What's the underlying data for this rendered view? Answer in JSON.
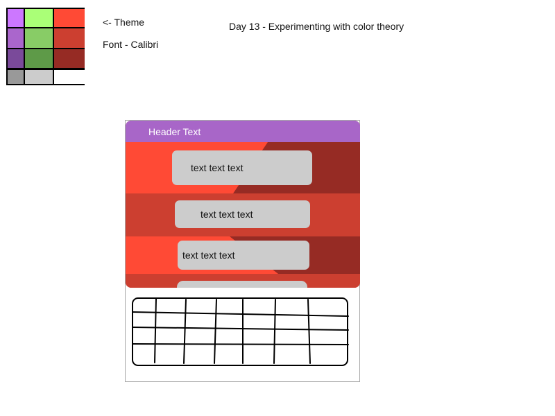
{
  "theme": {
    "label": "<- Theme",
    "font_label": "Font - Calibri",
    "swatches": [
      {
        "name": "light-purple",
        "color": "#cc77ff"
      },
      {
        "name": "light-green",
        "color": "#aaff77"
      },
      {
        "name": "red",
        "color": "#ff4a35"
      },
      {
        "name": "purple",
        "color": "#aa66cc"
      },
      {
        "name": "green",
        "color": "#88cc66"
      },
      {
        "name": "medium-red",
        "color": "#cc3f30"
      },
      {
        "name": "dark-purple",
        "color": "#7a4a9a"
      },
      {
        "name": "dark-green",
        "color": "#5e9a48"
      },
      {
        "name": "dark-red",
        "color": "#962b24"
      },
      {
        "name": "gray",
        "color": "#999999"
      },
      {
        "name": "light-gray",
        "color": "#cccccc"
      },
      {
        "name": "white",
        "color": "#ffffff"
      }
    ]
  },
  "title": "Day 13 - Experimenting with color theory",
  "mockup": {
    "header_text": "Header Text",
    "bubbles": [
      {
        "text": "text text text"
      },
      {
        "text": "text text text"
      },
      {
        "text": "text text text"
      }
    ],
    "colors": {
      "header": "#a866c8",
      "red": "#ff4a35",
      "medium_red": "#cc3f30",
      "dark_red": "#962b24",
      "bubble": "#cccccc"
    }
  }
}
